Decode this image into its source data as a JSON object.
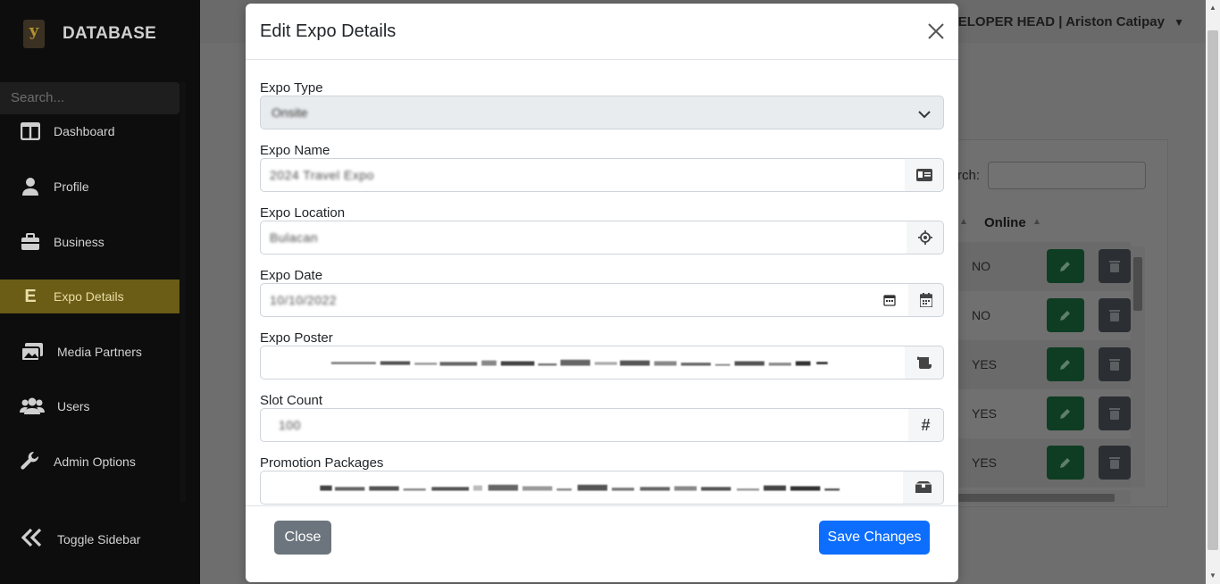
{
  "sidebar": {
    "brand_logo": "y",
    "brand": "DATABASE",
    "search_placeholder": "Search...",
    "items": [
      {
        "label": "Dashboard",
        "icon": "columns-icon"
      },
      {
        "label": "Profile",
        "icon": "user-icon"
      },
      {
        "label": "Business",
        "icon": "briefcase-icon"
      },
      {
        "label": "Expo Details",
        "icon": "letter-e-icon",
        "active": true
      },
      {
        "label": "Media Partners",
        "icon": "images-icon"
      },
      {
        "label": "Users",
        "icon": "users-icon"
      },
      {
        "label": "Admin Options",
        "icon": "wrench-icon"
      }
    ],
    "toggle_label": "Toggle Sidebar"
  },
  "header": {
    "user": "DEVELOPER HEAD | Ariston Catipay"
  },
  "background_table": {
    "search_label": "rch:",
    "column": "Online",
    "rows": [
      "NO",
      "NO",
      "YES",
      "YES",
      "YES"
    ]
  },
  "modal": {
    "title": "Edit Expo Details",
    "fields": {
      "expo_type": {
        "label": "Expo Type",
        "value": "Onsite"
      },
      "expo_name": {
        "label": "Expo Name",
        "value": "2024 Travel Expo"
      },
      "expo_location": {
        "label": "Expo Location",
        "value": "Bulacan"
      },
      "expo_date": {
        "label": "Expo Date",
        "value": "10/10/2022"
      },
      "expo_poster": {
        "label": "Expo Poster"
      },
      "slot_count": {
        "label": "Slot Count",
        "value": "100"
      },
      "promotion_packages": {
        "label": "Promotion Packages"
      }
    },
    "close_label": "Close",
    "save_label": "Save Changes"
  },
  "colors": {
    "sidebar_bg": "#0d0d0d",
    "active_nav": "#6b5c16",
    "primary": "#0d6efd",
    "secondary": "#6c757d",
    "edit_button": "#0e3d23",
    "delete_button": "#2b2f33"
  }
}
